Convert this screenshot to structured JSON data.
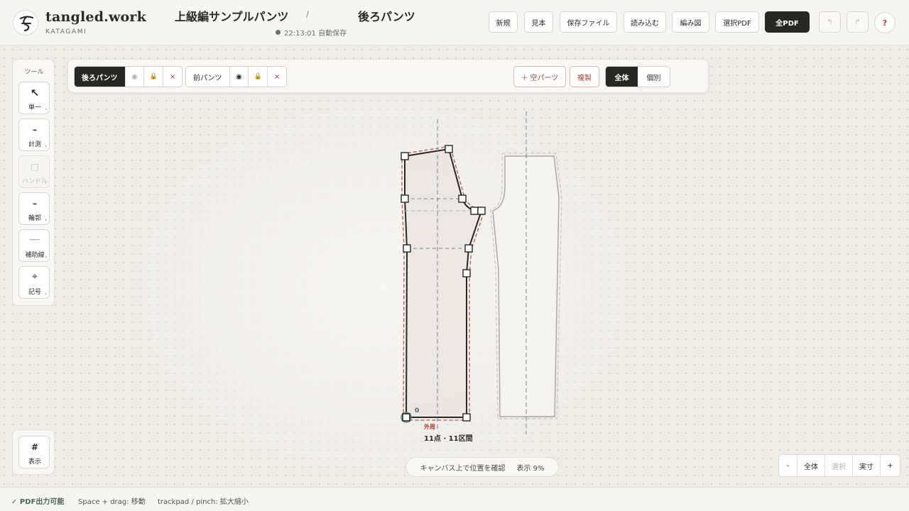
{
  "app": {
    "brand": "tangled.work",
    "brand_sub": "KATAGAMI",
    "doc_title": "上級編サンプルパンツ",
    "separator": "/",
    "part_title": "後ろパンツ",
    "autosave": "22:13:01 自動保存"
  },
  "header_buttons": {
    "new": "新規",
    "sample": "見本",
    "save_file": "保存ファイル",
    "load": "読み込む",
    "knit_chart": "編み図",
    "selected_pdf": "選択PDF",
    "all_pdf": "全PDF",
    "undo": "↰",
    "redo": "↱",
    "help": "?"
  },
  "tools": {
    "title": "ツール",
    "items": [
      {
        "label": "単一",
        "icon": "↖"
      },
      {
        "label": "計測",
        "icon": "⌁"
      },
      {
        "label": "ハンドル",
        "icon": "□"
      },
      {
        "label": "輪郭",
        "icon": "⌁"
      },
      {
        "label": "補助線",
        "icon": "------"
      },
      {
        "label": "記号",
        "icon": "⌖"
      }
    ],
    "caret": "›",
    "display": {
      "label": "表示",
      "icon": "#"
    }
  },
  "parts": {
    "tabs": [
      {
        "name": "後ろパンツ",
        "visible": "◉",
        "lock": "🔒",
        "close": "×",
        "active": true
      },
      {
        "name": "前パンツ",
        "visible": "◉",
        "lock": "🔒",
        "close": "×",
        "active": false
      }
    ],
    "add_empty": "＋ 空パーツ",
    "duplicate": "複製",
    "view_all": "全体",
    "view_single": "個別"
  },
  "canvas": {
    "origin_label": "0",
    "outline_label": "外周",
    "count_label": "11点 · 11区間"
  },
  "status": {
    "hint": "キャンバス上で位置を確認",
    "zoom": "表示 9%"
  },
  "zoom_controls": {
    "minus": "-",
    "fit_all": "全体",
    "selection": "選択",
    "actual": "実寸",
    "plus": "+"
  },
  "footer": {
    "pdf_ok": "✓ PDF出力可能",
    "pan_hint": "Space + drag: 移動",
    "zoom_hint": "trackpad / pinch: 拡大縮小"
  },
  "colors": {
    "accent_dark": "#262823",
    "accent_red": "#b23a2b",
    "guide_teal": "#5f8d96"
  }
}
